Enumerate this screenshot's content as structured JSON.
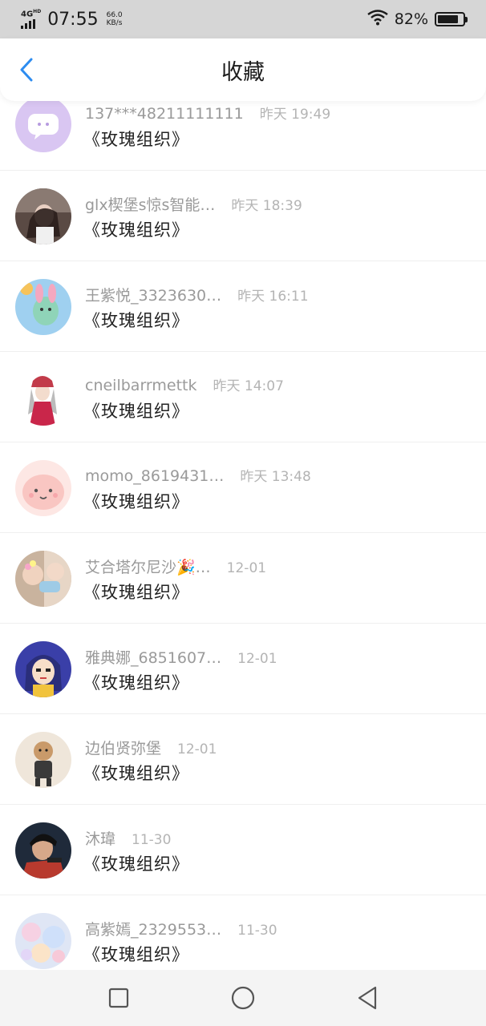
{
  "status_bar": {
    "network": "4G",
    "network_hd": "HD",
    "time": "07:55",
    "speed_value": "66.0",
    "speed_unit": "KB/s",
    "battery_percent": "82%",
    "battery_level": 0.82
  },
  "header": {
    "title": "收藏",
    "back_icon": "chevron-left-icon"
  },
  "colors": {
    "accent": "#2d8cf0",
    "username": "#9a9a9a",
    "time": "#b4b4b4"
  },
  "items": [
    {
      "username": "137***48211111111",
      "time": "昨天 19:49",
      "title": "《玫瑰组织》"
    },
    {
      "username": "glx楔堡s惊s智能…",
      "time": "昨天 18:39",
      "title": "《玫瑰组织》"
    },
    {
      "username": "王紫悦_3323630…",
      "time": "昨天 16:11",
      "title": "《玫瑰组织》"
    },
    {
      "username": "cneilbarrmettk",
      "time": "昨天 14:07",
      "title": "《玫瑰组织》"
    },
    {
      "username": "momo_8619431…",
      "time": "昨天 13:48",
      "title": "《玫瑰组织》"
    },
    {
      "username": "艾合塔尔尼沙🎉…",
      "time": "12-01",
      "title": "《玫瑰组织》"
    },
    {
      "username": "雅典娜_6851607…",
      "time": "12-01",
      "title": "《玫瑰组织》"
    },
    {
      "username": "边伯贤弥堡",
      "time": "12-01",
      "title": "《玫瑰组织》"
    },
    {
      "username": "沐瑋",
      "time": "11-30",
      "title": "《玫瑰组织》"
    },
    {
      "username": "高紫嫣_2329553…",
      "time": "11-30",
      "title": "《玫瑰组织》"
    }
  ],
  "nav": {
    "recent_icon": "square-icon",
    "home_icon": "circle-icon",
    "back_icon": "triangle-back-icon"
  }
}
